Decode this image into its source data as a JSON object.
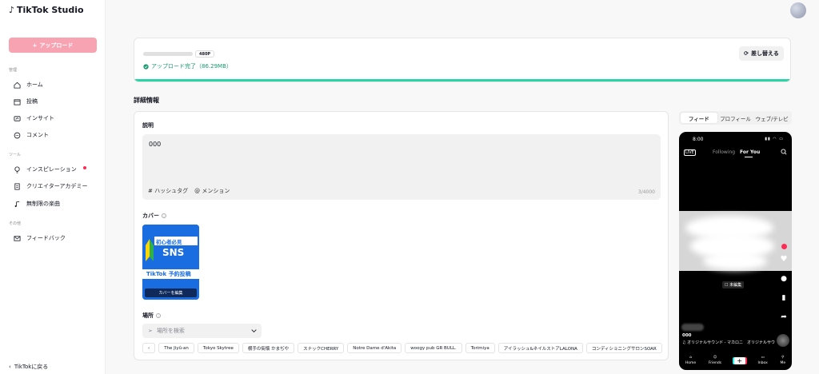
{
  "app": {
    "logo_text": "TikTok Studio"
  },
  "sidebar": {
    "upload_label": "アップロード",
    "section_manage": "管理",
    "section_tools": "ツール",
    "section_other": "その他",
    "items": [
      {
        "label": "ホーム",
        "icon": "home-icon"
      },
      {
        "label": "投稿",
        "icon": "posts-icon"
      },
      {
        "label": "インサイト",
        "icon": "insights-icon"
      },
      {
        "label": "コメント",
        "icon": "comment-icon"
      },
      {
        "label": "インスピレーション",
        "icon": "lightbulb-icon"
      },
      {
        "label": "クリエイターアカデミー",
        "icon": "academy-icon"
      },
      {
        "label": "無制限の楽曲",
        "icon": "music-icon"
      },
      {
        "label": "フィードバック",
        "icon": "mail-icon"
      }
    ],
    "back_label": "TikTokに戻る"
  },
  "file": {
    "resolution": "480P",
    "status": "アップロード完了（86.29MB）",
    "progress": 1.0,
    "replace_label": "差し替える"
  },
  "details": {
    "section_title": "詳細情報",
    "description_label": "説明",
    "description_value": "000",
    "hashtag_label": "# ハッシュタグ",
    "mention_label": "@ メンション",
    "char_count": "3/4000",
    "cover_label": "カバー",
    "cover_edit_label": "カバーを編集",
    "cover_text_line1": "初心者必見",
    "cover_text_line2": "SNS",
    "cover_text_line3": "TikTok 予約投稿",
    "location_label": "場所",
    "location_placeholder": "場所を検索",
    "location_chips": [
      "The Jiyû-an",
      "Tokyo Skytree",
      "横手の街懐 かまぢや",
      "スナックCHERRY",
      "Notre Dame d'Akita",
      "woogy pub GR BULL.",
      "Torimiya",
      "アイラッシュ&ネイルストアLALONA",
      "コンディショニングサロンSOAR"
    ]
  },
  "preview": {
    "tabs": [
      "フィード",
      "プロフィール",
      "ウェブ/テレビ"
    ],
    "active_tab": 0,
    "time": "8:00",
    "following_label": "Following",
    "for_you_label": "For You",
    "live_label": "LIVE",
    "tag_label": "☐ 未編集",
    "caption": "000",
    "sound": "♫ オリジナルサウンド - マカロニ　オリジナルサウ",
    "nav": [
      "Home",
      "Friends",
      "",
      "Inbox",
      "Me"
    ]
  },
  "colors": {
    "accent": "#fe2c55",
    "upload_btn": "#f7a3b2",
    "success": "#1a9a6e",
    "progress": "#2bd4a4"
  }
}
